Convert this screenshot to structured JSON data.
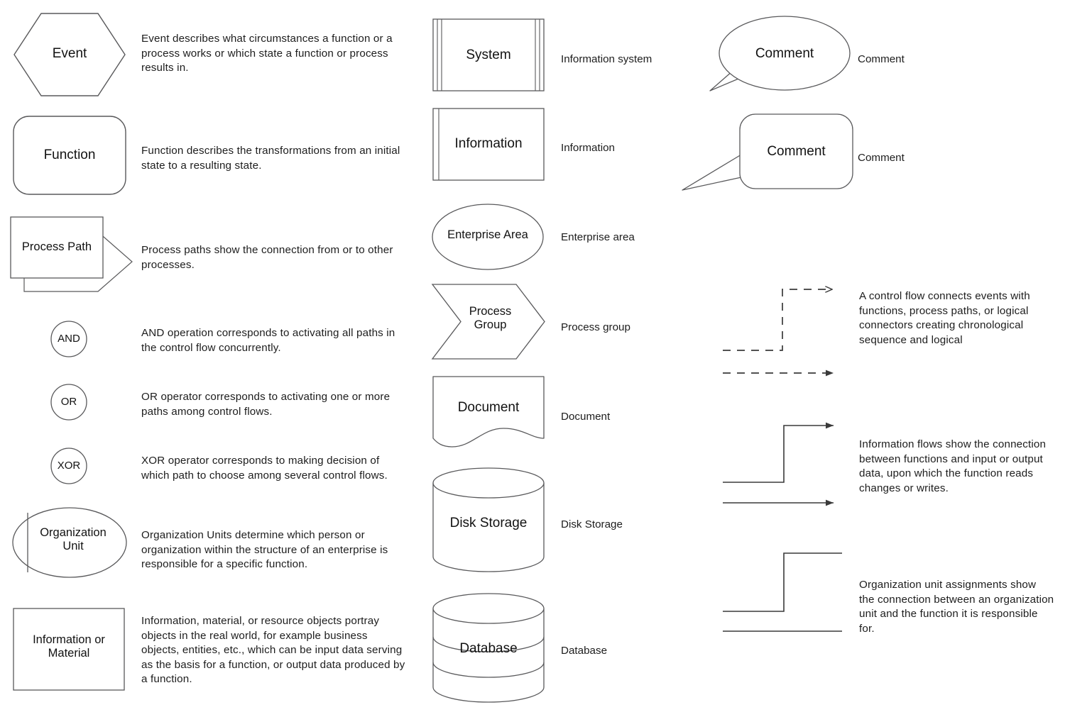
{
  "meta": {
    "stroke_color": "#59595b",
    "text_color": "#1d1d1d",
    "background": "#ffffff"
  },
  "column_left": {
    "items": [
      {
        "shape": "hexagon",
        "shape_label": "Event",
        "description": "Event describes what circumstances a function or a process works or which state a function or process results in."
      },
      {
        "shape": "rounded-rectangle",
        "shape_label": "Function",
        "description": "Function describes the transformations from an initial state to a resulting state."
      },
      {
        "shape": "process-path",
        "shape_label": "Process Path",
        "description": "Process paths show the connection from or to other processes."
      },
      {
        "shape": "circle",
        "shape_label": "AND",
        "description": "AND operation corresponds to activating all paths in the control flow concurrently."
      },
      {
        "shape": "circle",
        "shape_label": "OR",
        "description": "OR operator corresponds to activating one or more paths among control flows."
      },
      {
        "shape": "circle",
        "shape_label": "XOR",
        "description": "XOR operator corresponds to making decision of which path to choose among several control flows."
      },
      {
        "shape": "organization-unit-ellipse",
        "shape_label": "Organization\nUnit",
        "description": "Organization Units determine which person or organization within the structure of an enterprise is responsible for a specific function."
      },
      {
        "shape": "rectangle",
        "shape_label": "Information or\nMaterial",
        "description": "Information, material, or resource objects portray objects in the real world, for example business objects, entities, etc., which can be input data serving as the basis for a function, or output data produced by a function."
      }
    ]
  },
  "column_middle": {
    "items": [
      {
        "shape": "system-box",
        "shape_label": "System",
        "caption": "Information system"
      },
      {
        "shape": "information-box",
        "shape_label": "Information",
        "caption": "Information"
      },
      {
        "shape": "ellipse",
        "shape_label": "Enterprise Area",
        "caption": "Enterprise area"
      },
      {
        "shape": "chevron",
        "shape_label": "Process\nGroup",
        "caption": "Process group"
      },
      {
        "shape": "document",
        "shape_label": "Document",
        "caption": "Document"
      },
      {
        "shape": "cylinder",
        "shape_label": "Disk Storage",
        "caption": "Disk Storage"
      },
      {
        "shape": "stacked-cylinder",
        "shape_label": "Database",
        "caption": "Database"
      }
    ]
  },
  "column_right": {
    "comments": [
      {
        "shape": "comment-ellipse-callout",
        "shape_label": "Comment",
        "caption": "Comment"
      },
      {
        "shape": "comment-rounded-callout",
        "shape_label": "Comment",
        "caption": "Comment"
      }
    ],
    "connectors": [
      {
        "shape": "dashed-step-arrow",
        "description": "A control flow connects events with functions, process paths, or logical connectors creating chronological sequence and logical"
      },
      {
        "shape": "solid-step-arrow",
        "description": "Information flows show the connection between functions and input or output data, upon which the function reads changes or writes."
      },
      {
        "shape": "plain-step-line",
        "description": "Organization unit assignments show the connection between an organization unit and the function it is responsible for."
      }
    ]
  }
}
